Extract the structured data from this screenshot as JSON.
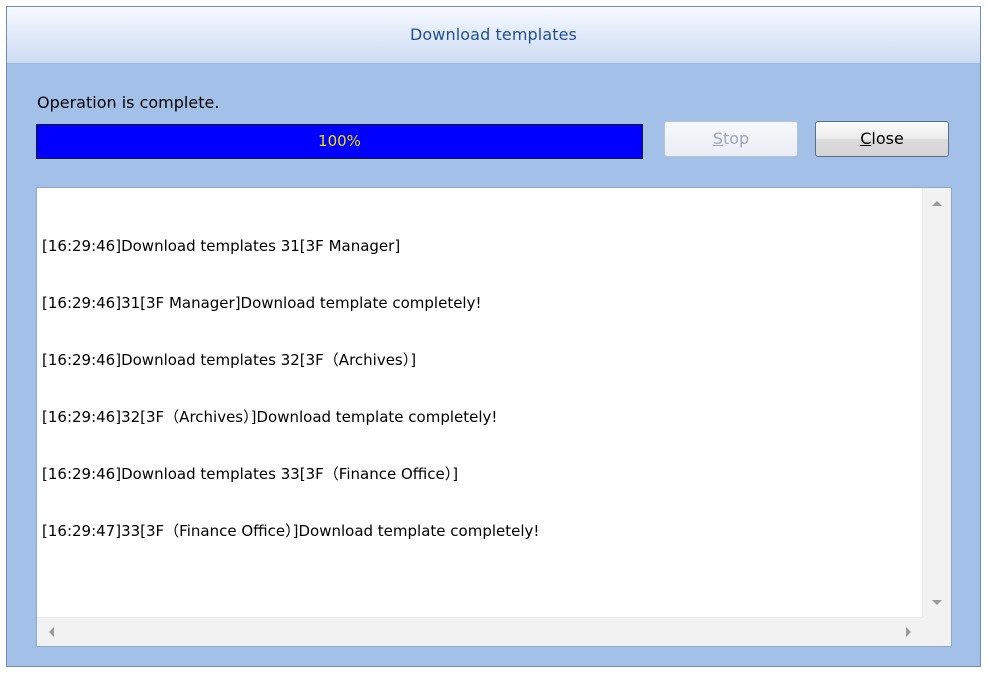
{
  "window": {
    "title": "Download templates"
  },
  "status": {
    "message": "Operation is complete."
  },
  "progress": {
    "value": 1.0,
    "label": "100%",
    "fill_color": "#0000ff",
    "label_color": "#f0e000"
  },
  "buttons": {
    "stop": {
      "mnemonic": "S",
      "rest": "top",
      "enabled": false
    },
    "close": {
      "mnemonic": "C",
      "rest": "lose",
      "enabled": true
    }
  },
  "log": {
    "lines": [
      "[16:29:46]Download templates 31[3F Manager]",
      "[16:29:46]31[3F Manager]Download template completely!",
      "[16:29:46]Download templates 32[3F（Archives）]",
      "[16:29:46]32[3F（Archives）]Download template completely!",
      "[16:29:46]Download templates 33[3F（Finance Office）]",
      "[16:29:47]33[3F（Finance Office）]Download template completely!"
    ]
  },
  "icons": {
    "scroll_up": "scroll-up-arrow-icon",
    "scroll_down": "scroll-down-arrow-icon",
    "scroll_left": "scroll-left-arrow-icon",
    "scroll_right": "scroll-right-arrow-icon"
  }
}
